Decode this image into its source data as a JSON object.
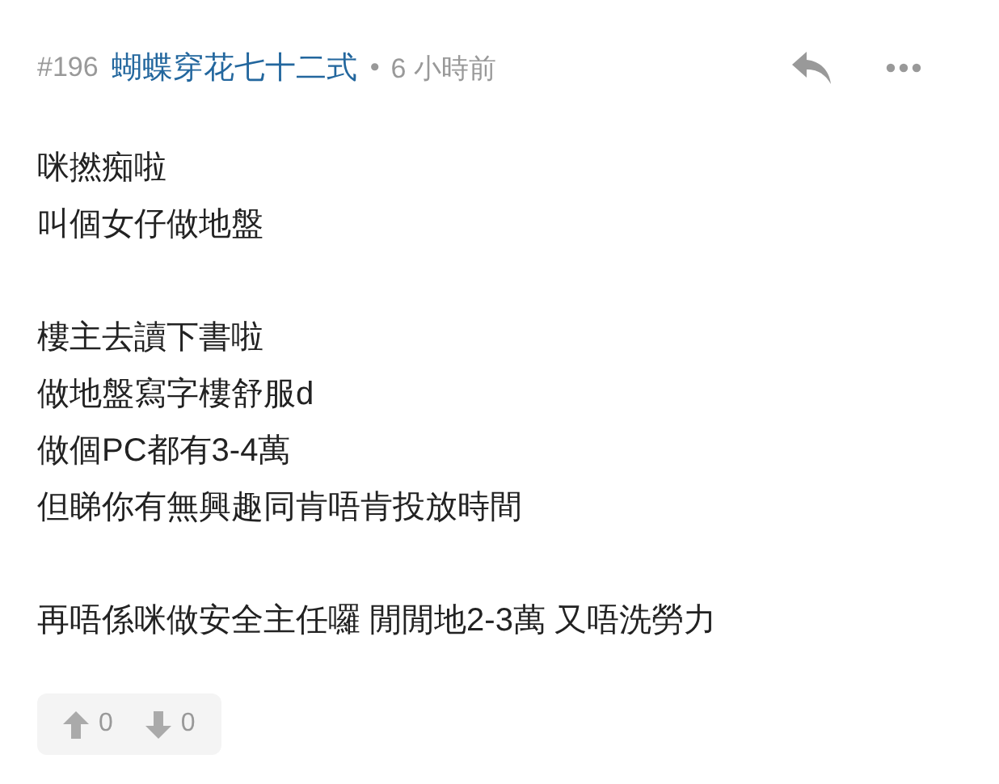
{
  "post": {
    "number": "#196",
    "author": "蝴蝶穿花七十二式",
    "separator": "•",
    "time": "6 小時前"
  },
  "paragraphs": [
    [
      "咪撚痴啦",
      "叫個女仔做地盤"
    ],
    [
      "樓主去讀下書啦",
      "做地盤寫字樓舒服d",
      "做個PC都有3-4萬",
      "但睇你有無興趣同肯唔肯投放時間"
    ],
    [
      "再唔係咪做安全主任囉 閒閒地2-3萬 又唔洗勞力"
    ]
  ],
  "votes": {
    "up": "0",
    "down": "0"
  }
}
